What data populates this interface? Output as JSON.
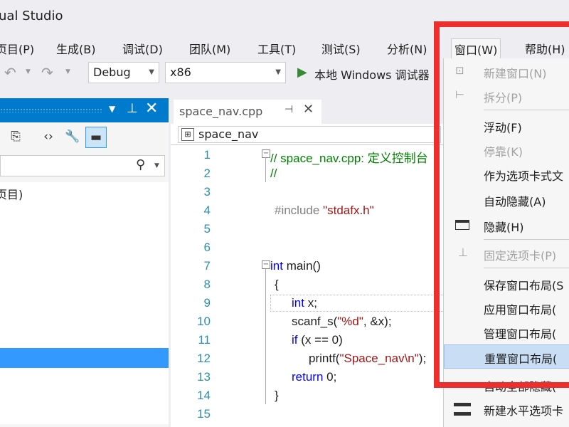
{
  "app": {
    "title": "ual Studio"
  },
  "menubar": {
    "items": [
      {
        "label": "页目(P)"
      },
      {
        "label": "生成(B)"
      },
      {
        "label": "调试(D)"
      },
      {
        "label": "团队(M)"
      },
      {
        "label": "工具(T)"
      },
      {
        "label": "测试(S)"
      },
      {
        "label": "分析(N)"
      },
      {
        "label": "窗口(W)"
      },
      {
        "label": "帮助(H)"
      }
    ]
  },
  "toolbar": {
    "config": "Debug",
    "platform": "x86",
    "run_label": "本地 Windows 调试器"
  },
  "solution_explorer": {
    "tree_item": "页目)",
    "search_icon": "search-icon"
  },
  "editor": {
    "tab_title": "space_nav.cpp",
    "nav_scope": "space_nav",
    "line_numbers": [
      "1",
      "2",
      "3",
      "4",
      "5",
      "6",
      "7",
      "8",
      "9",
      "10",
      "11",
      "12",
      "13",
      "14",
      "15"
    ],
    "lines": [
      {
        "text": "// space_nav.cpp: 定义控制台",
        "kind": "comment"
      },
      {
        "text": "//",
        "kind": "comment"
      },
      {
        "text": "",
        "kind": "plain"
      },
      {
        "text_pp": "#include ",
        "text_str": "\"stdafx.h\"",
        "kind": "include"
      },
      {
        "text": "",
        "kind": "plain"
      },
      {
        "text": "",
        "kind": "plain"
      },
      {
        "text_kw": "int",
        "text_rest": " main()",
        "kind": "kw"
      },
      {
        "text": "{",
        "kind": "plain"
      },
      {
        "text_kw": "int",
        "text_rest": " x;",
        "kind": "kw"
      },
      {
        "text_fn": "scanf_s(",
        "text_str": "\"%d\"",
        "text_rest": ", &x);",
        "kind": "call"
      },
      {
        "text_kw": "if",
        "text_rest": " (x == 0)",
        "kind": "kw"
      },
      {
        "text_fn": "printf(",
        "text_str": "\"Space_nav\\n\"",
        "text_rest": ");",
        "kind": "call"
      },
      {
        "text_kw": "return",
        "text_rest": " 0;",
        "kind": "kw"
      },
      {
        "text": "}",
        "kind": "plain"
      },
      {
        "text": "",
        "kind": "plain"
      }
    ]
  },
  "window_menu": {
    "items": [
      {
        "label": "新建窗口(N)",
        "disabled": true,
        "icon": "new-window-icon"
      },
      {
        "label": "拆分(P)",
        "disabled": true,
        "icon": "split-icon"
      },
      {
        "label": "浮动(F)",
        "disabled": false
      },
      {
        "label": "停靠(K)",
        "disabled": true
      },
      {
        "label": "作为选项卡式文",
        "disabled": false
      },
      {
        "label": "自动隐藏(A)",
        "disabled": false
      },
      {
        "label": "隐藏(H)",
        "disabled": false,
        "icon": "hide-window-icon"
      },
      {
        "label": "固定选项卡(P)",
        "disabled": true,
        "icon": "pin-icon"
      },
      {
        "label": "保存窗口布局(S",
        "disabled": false
      },
      {
        "label": "应用窗口布局(",
        "disabled": false
      },
      {
        "label": "管理窗口布局(",
        "disabled": false
      },
      {
        "label": "重置窗口布局(",
        "disabled": false,
        "highlighted": true
      },
      {
        "label": "自动全部隐藏(",
        "disabled": false
      },
      {
        "label": "新建水平选项卡",
        "disabled": false,
        "icon": "horizontal-tab-group-icon"
      }
    ]
  },
  "colors": {
    "accent": "#007acc",
    "highlight_border": "#ee2d2d",
    "keyword": "#0000ff",
    "comment": "#008000",
    "string": "#a31515",
    "preprocessor": "#808080",
    "line_number": "#2b91af"
  }
}
